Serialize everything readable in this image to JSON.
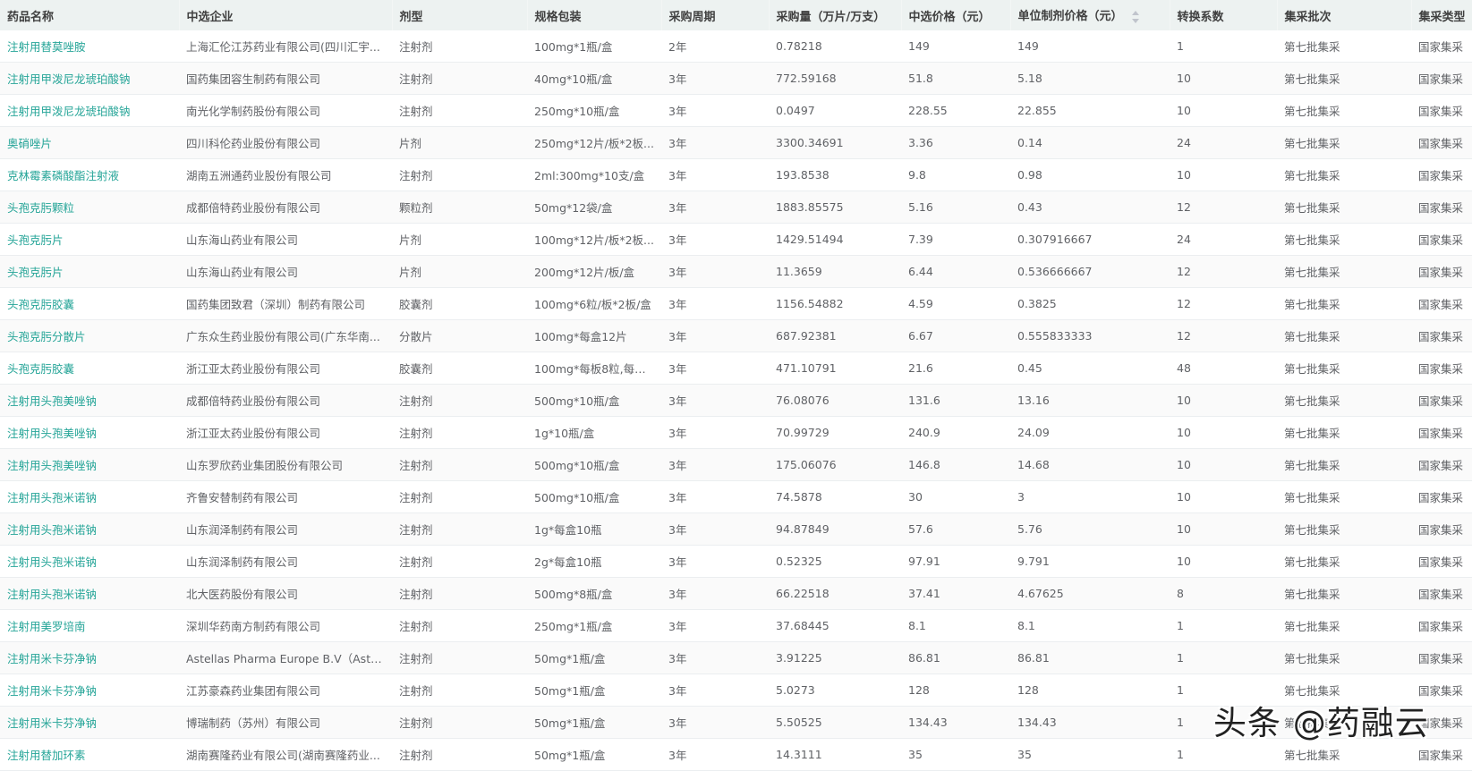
{
  "colors": {
    "link": "#26a598",
    "header_bg": "#edf2f1"
  },
  "table": {
    "headers": [
      "药品名称",
      "中选企业",
      "剂型",
      "规格包装",
      "采购周期",
      "采购量（万片/万支）",
      "中选价格（元）",
      "单位制剂价格（元）",
      "转换系数",
      "集采批次",
      "集采类型"
    ],
    "sort_icon": "sort-caret-icon",
    "rows": [
      [
        "注射用替莫唑胺",
        "上海汇伦江苏药业有限公司(四川汇宇...",
        "注射剂",
        "100mg*1瓶/盒",
        "2年",
        "0.78218",
        "149",
        "149",
        "1",
        "第七批集采",
        "国家集采"
      ],
      [
        "注射用甲泼尼龙琥珀酸钠",
        "国药集团容生制药有限公司",
        "注射剂",
        "40mg*10瓶/盒",
        "3年",
        "772.59168",
        "51.8",
        "5.18",
        "10",
        "第七批集采",
        "国家集采"
      ],
      [
        "注射用甲泼尼龙琥珀酸钠",
        "南光化学制药股份有限公司",
        "注射剂",
        "250mg*10瓶/盒",
        "3年",
        "0.0497",
        "228.55",
        "22.855",
        "10",
        "第七批集采",
        "国家集采"
      ],
      [
        "奥硝唑片",
        "四川科伦药业股份有限公司",
        "片剂",
        "250mg*12片/板*2板...",
        "3年",
        "3300.34691",
        "3.36",
        "0.14",
        "24",
        "第七批集采",
        "国家集采"
      ],
      [
        "克林霉素磷酸酯注射液",
        "湖南五洲通药业股份有限公司",
        "注射剂",
        "2ml:300mg*10支/盒",
        "3年",
        "193.8538",
        "9.8",
        "0.98",
        "10",
        "第七批集采",
        "国家集采"
      ],
      [
        "头孢克肟颗粒",
        "成都倍特药业股份有限公司",
        "颗粒剂",
        "50mg*12袋/盒",
        "3年",
        "1883.85575",
        "5.16",
        "0.43",
        "12",
        "第七批集采",
        "国家集采"
      ],
      [
        "头孢克肟片",
        "山东海山药业有限公司",
        "片剂",
        "100mg*12片/板*2板...",
        "3年",
        "1429.51494",
        "7.39",
        "0.307916667",
        "24",
        "第七批集采",
        "国家集采"
      ],
      [
        "头孢克肟片",
        "山东海山药业有限公司",
        "片剂",
        "200mg*12片/板/盒",
        "3年",
        "11.3659",
        "6.44",
        "0.536666667",
        "12",
        "第七批集采",
        "国家集采"
      ],
      [
        "头孢克肟胶囊",
        "国药集团致君（深圳）制药有限公司",
        "胶囊剂",
        "100mg*6粒/板*2板/盒",
        "3年",
        "1156.54882",
        "4.59",
        "0.3825",
        "12",
        "第七批集采",
        "国家集采"
      ],
      [
        "头孢克肟分散片",
        "广东众生药业股份有限公司(广东华南...",
        "分散片",
        "100mg*每盒12片",
        "3年",
        "687.92381",
        "6.67",
        "0.555833333",
        "12",
        "第七批集采",
        "国家集采"
      ],
      [
        "头孢克肟胶囊",
        "浙江亚太药业股份有限公司",
        "胶囊剂",
        "100mg*每板8粒,每盒...",
        "3年",
        "471.10791",
        "21.6",
        "0.45",
        "48",
        "第七批集采",
        "国家集采"
      ],
      [
        "注射用头孢美唑钠",
        "成都倍特药业股份有限公司",
        "注射剂",
        "500mg*10瓶/盒",
        "3年",
        "76.08076",
        "131.6",
        "13.16",
        "10",
        "第七批集采",
        "国家集采"
      ],
      [
        "注射用头孢美唑钠",
        "浙江亚太药业股份有限公司",
        "注射剂",
        "1g*10瓶/盒",
        "3年",
        "70.99729",
        "240.9",
        "24.09",
        "10",
        "第七批集采",
        "国家集采"
      ],
      [
        "注射用头孢美唑钠",
        "山东罗欣药业集团股份有限公司",
        "注射剂",
        "500mg*10瓶/盒",
        "3年",
        "175.06076",
        "146.8",
        "14.68",
        "10",
        "第七批集采",
        "国家集采"
      ],
      [
        "注射用头孢米诺钠",
        "齐鲁安替制药有限公司",
        "注射剂",
        "500mg*10瓶/盒",
        "3年",
        "74.5878",
        "30",
        "3",
        "10",
        "第七批集采",
        "国家集采"
      ],
      [
        "注射用头孢米诺钠",
        "山东润泽制药有限公司",
        "注射剂",
        "1g*每盒10瓶",
        "3年",
        "94.87849",
        "57.6",
        "5.76",
        "10",
        "第七批集采",
        "国家集采"
      ],
      [
        "注射用头孢米诺钠",
        "山东润泽制药有限公司",
        "注射剂",
        "2g*每盒10瓶",
        "3年",
        "0.52325",
        "97.91",
        "9.791",
        "10",
        "第七批集采",
        "国家集采"
      ],
      [
        "注射用头孢米诺钠",
        "北大医药股份有限公司",
        "注射剂",
        "500mg*8瓶/盒",
        "3年",
        "66.22518",
        "37.41",
        "4.67625",
        "8",
        "第七批集采",
        "国家集采"
      ],
      [
        "注射用美罗培南",
        "深圳华药南方制药有限公司",
        "注射剂",
        "250mg*1瓶/盒",
        "3年",
        "37.68445",
        "8.1",
        "8.1",
        "1",
        "第七批集采",
        "国家集采"
      ],
      [
        "注射用米卡芬净钠",
        "Astellas Pharma Europe B.V（Astell...",
        "注射剂",
        "50mg*1瓶/盒",
        "3年",
        "3.91225",
        "86.81",
        "86.81",
        "1",
        "第七批集采",
        "国家集采"
      ],
      [
        "注射用米卡芬净钠",
        "江苏豪森药业集团有限公司",
        "注射剂",
        "50mg*1瓶/盒",
        "3年",
        "5.0273",
        "128",
        "128",
        "1",
        "第七批集采",
        "国家集采"
      ],
      [
        "注射用米卡芬净钠",
        "博瑞制药（苏州）有限公司",
        "注射剂",
        "50mg*1瓶/盒",
        "3年",
        "5.50525",
        "134.43",
        "134.43",
        "1",
        "第七批集采",
        "国家集采"
      ],
      [
        "注射用替加环素",
        "湖南赛隆药业有限公司(湖南赛隆药业...",
        "注射剂",
        "50mg*1瓶/盒",
        "3年",
        "14.3111",
        "35",
        "35",
        "1",
        "第七批集采",
        "国家集采"
      ]
    ]
  },
  "watermark": "头条 @药融云"
}
